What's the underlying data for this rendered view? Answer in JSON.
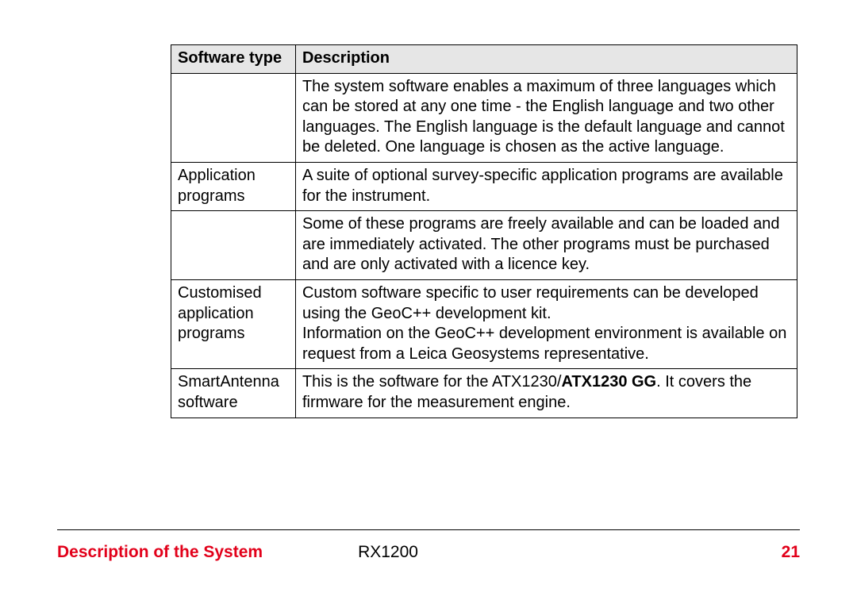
{
  "table": {
    "headers": {
      "type": "Software type",
      "desc": "Description"
    },
    "rows": [
      {
        "type": "",
        "desc": "The system software enables a maximum of three languages which can be stored at any one time - the English language and two other languages. The English language is the default language and cannot be deleted. One language is chosen as the active language."
      },
      {
        "type": "Application programs",
        "desc": "A suite of optional survey-specific application programs are available for the instrument."
      },
      {
        "type": "",
        "desc": "Some of these programs are freely available and can be loaded and are immediately activated. The other programs must be purchased and are only activated with a licence key."
      },
      {
        "type": "Customised application programs",
        "desc": "Custom software specific to user requirements can be developed using the GeoC++ development kit.\nInformation on the GeoC++ development environment is available on request from a Leica Geosystems representative."
      },
      {
        "type": "SmartAntenna software",
        "desc_pre": "This is the software for the ATX1230/",
        "desc_bold": "ATX1230 GG",
        "desc_post": ". It covers the firmware for the measurement engine."
      }
    ]
  },
  "footer": {
    "section": "Description of the System",
    "model": "RX1200",
    "page": "21"
  }
}
